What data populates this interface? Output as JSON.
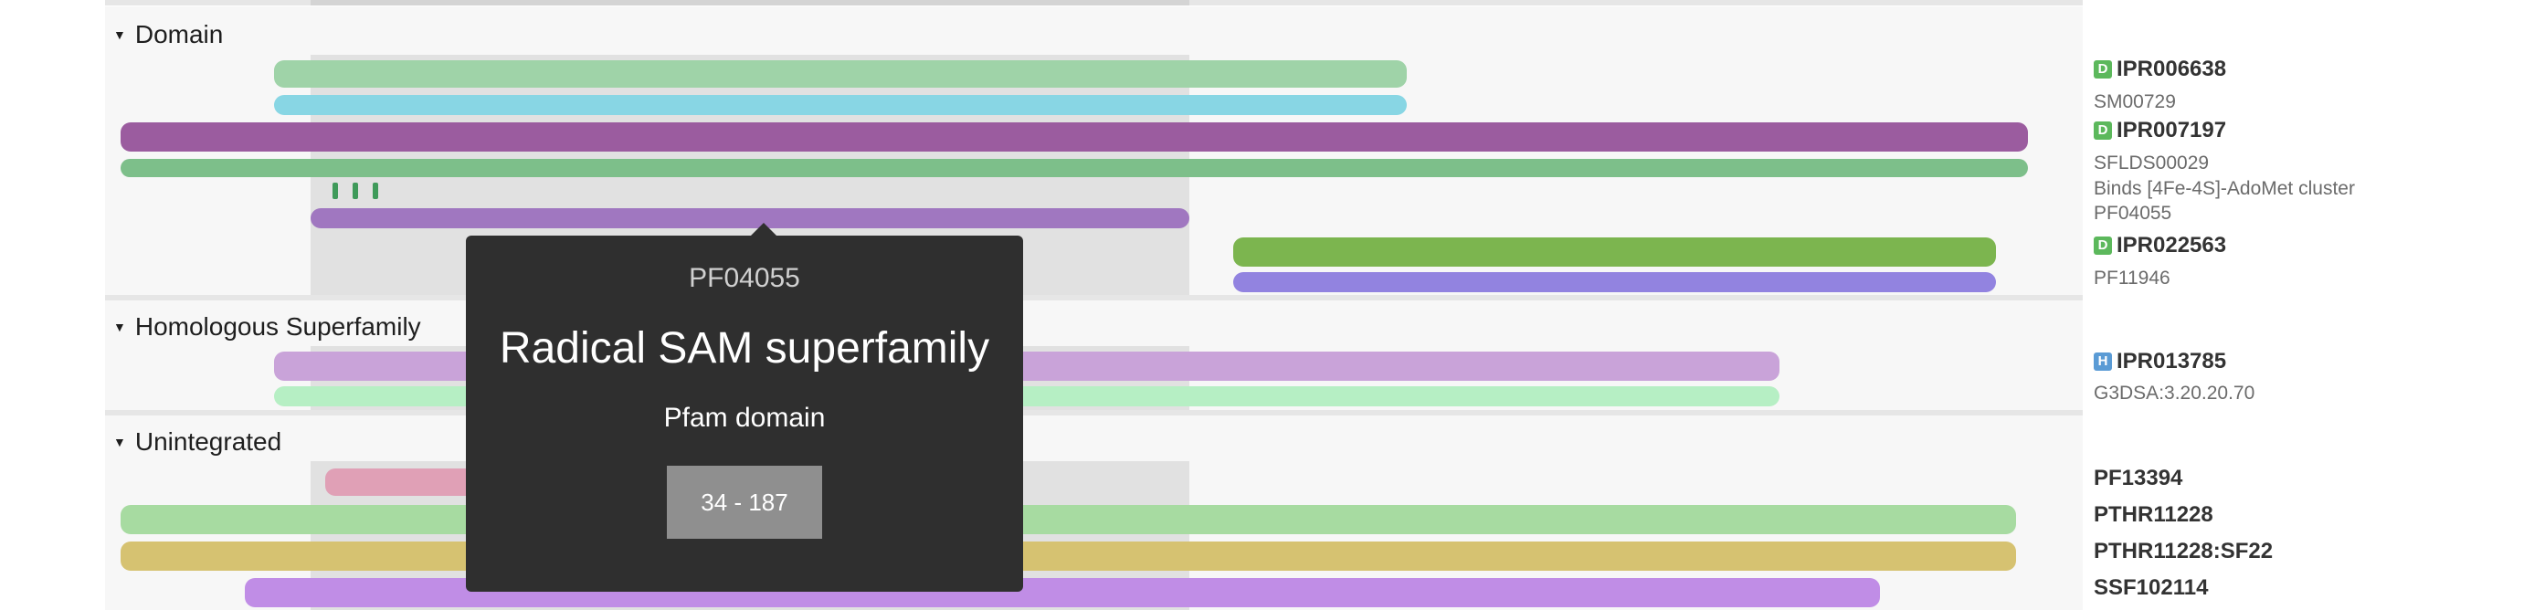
{
  "sections": [
    {
      "title": "Domain"
    },
    {
      "title": "Homologous Superfamily"
    },
    {
      "title": "Unintegrated"
    }
  ],
  "labels": {
    "domain": [
      {
        "badge": "D",
        "text": "IPR006638"
      },
      {
        "text": "SM00729"
      },
      {
        "badge": "D",
        "text": "IPR007197"
      },
      {
        "text": "SFLDS00029"
      },
      {
        "text": "Binds [4Fe-4S]-AdoMet cluster"
      },
      {
        "text": "PF04055"
      },
      {
        "badge": "D",
        "text": "IPR022563"
      },
      {
        "text": "PF11946"
      }
    ],
    "homologous": [
      {
        "badge": "H",
        "text": "IPR013785"
      },
      {
        "text": "G3DSA:3.20.20.70"
      }
    ],
    "unintegrated": [
      {
        "text": "PF13394"
      },
      {
        "text": "PTHR11228"
      },
      {
        "text": "PTHR11228:SF22"
      },
      {
        "text": "SSF102114"
      }
    ]
  },
  "colors": {
    "ipr006638": "#9fd3a8",
    "sm00729": "#88d6e4",
    "ipr007197": "#9b5c9f",
    "sflds00029": "#7dbf8a",
    "binding_site": "#3f9a5a",
    "pf04055": "#a077c0",
    "ipr022563": "#7cb54f",
    "pf11946": "#9283e0",
    "ipr013785": "#c9a3d9",
    "g3dsa": "#b6efc4",
    "pf13394": "#e0a0b6",
    "pthr11228": "#a7dba1",
    "pthr11228_sf22": "#d6c271",
    "ssf102114": "#c08de6"
  },
  "tooltip": {
    "accession": "PF04055",
    "title": "Radical SAM superfamily",
    "type": "Pfam domain",
    "range": "34 - 187"
  }
}
